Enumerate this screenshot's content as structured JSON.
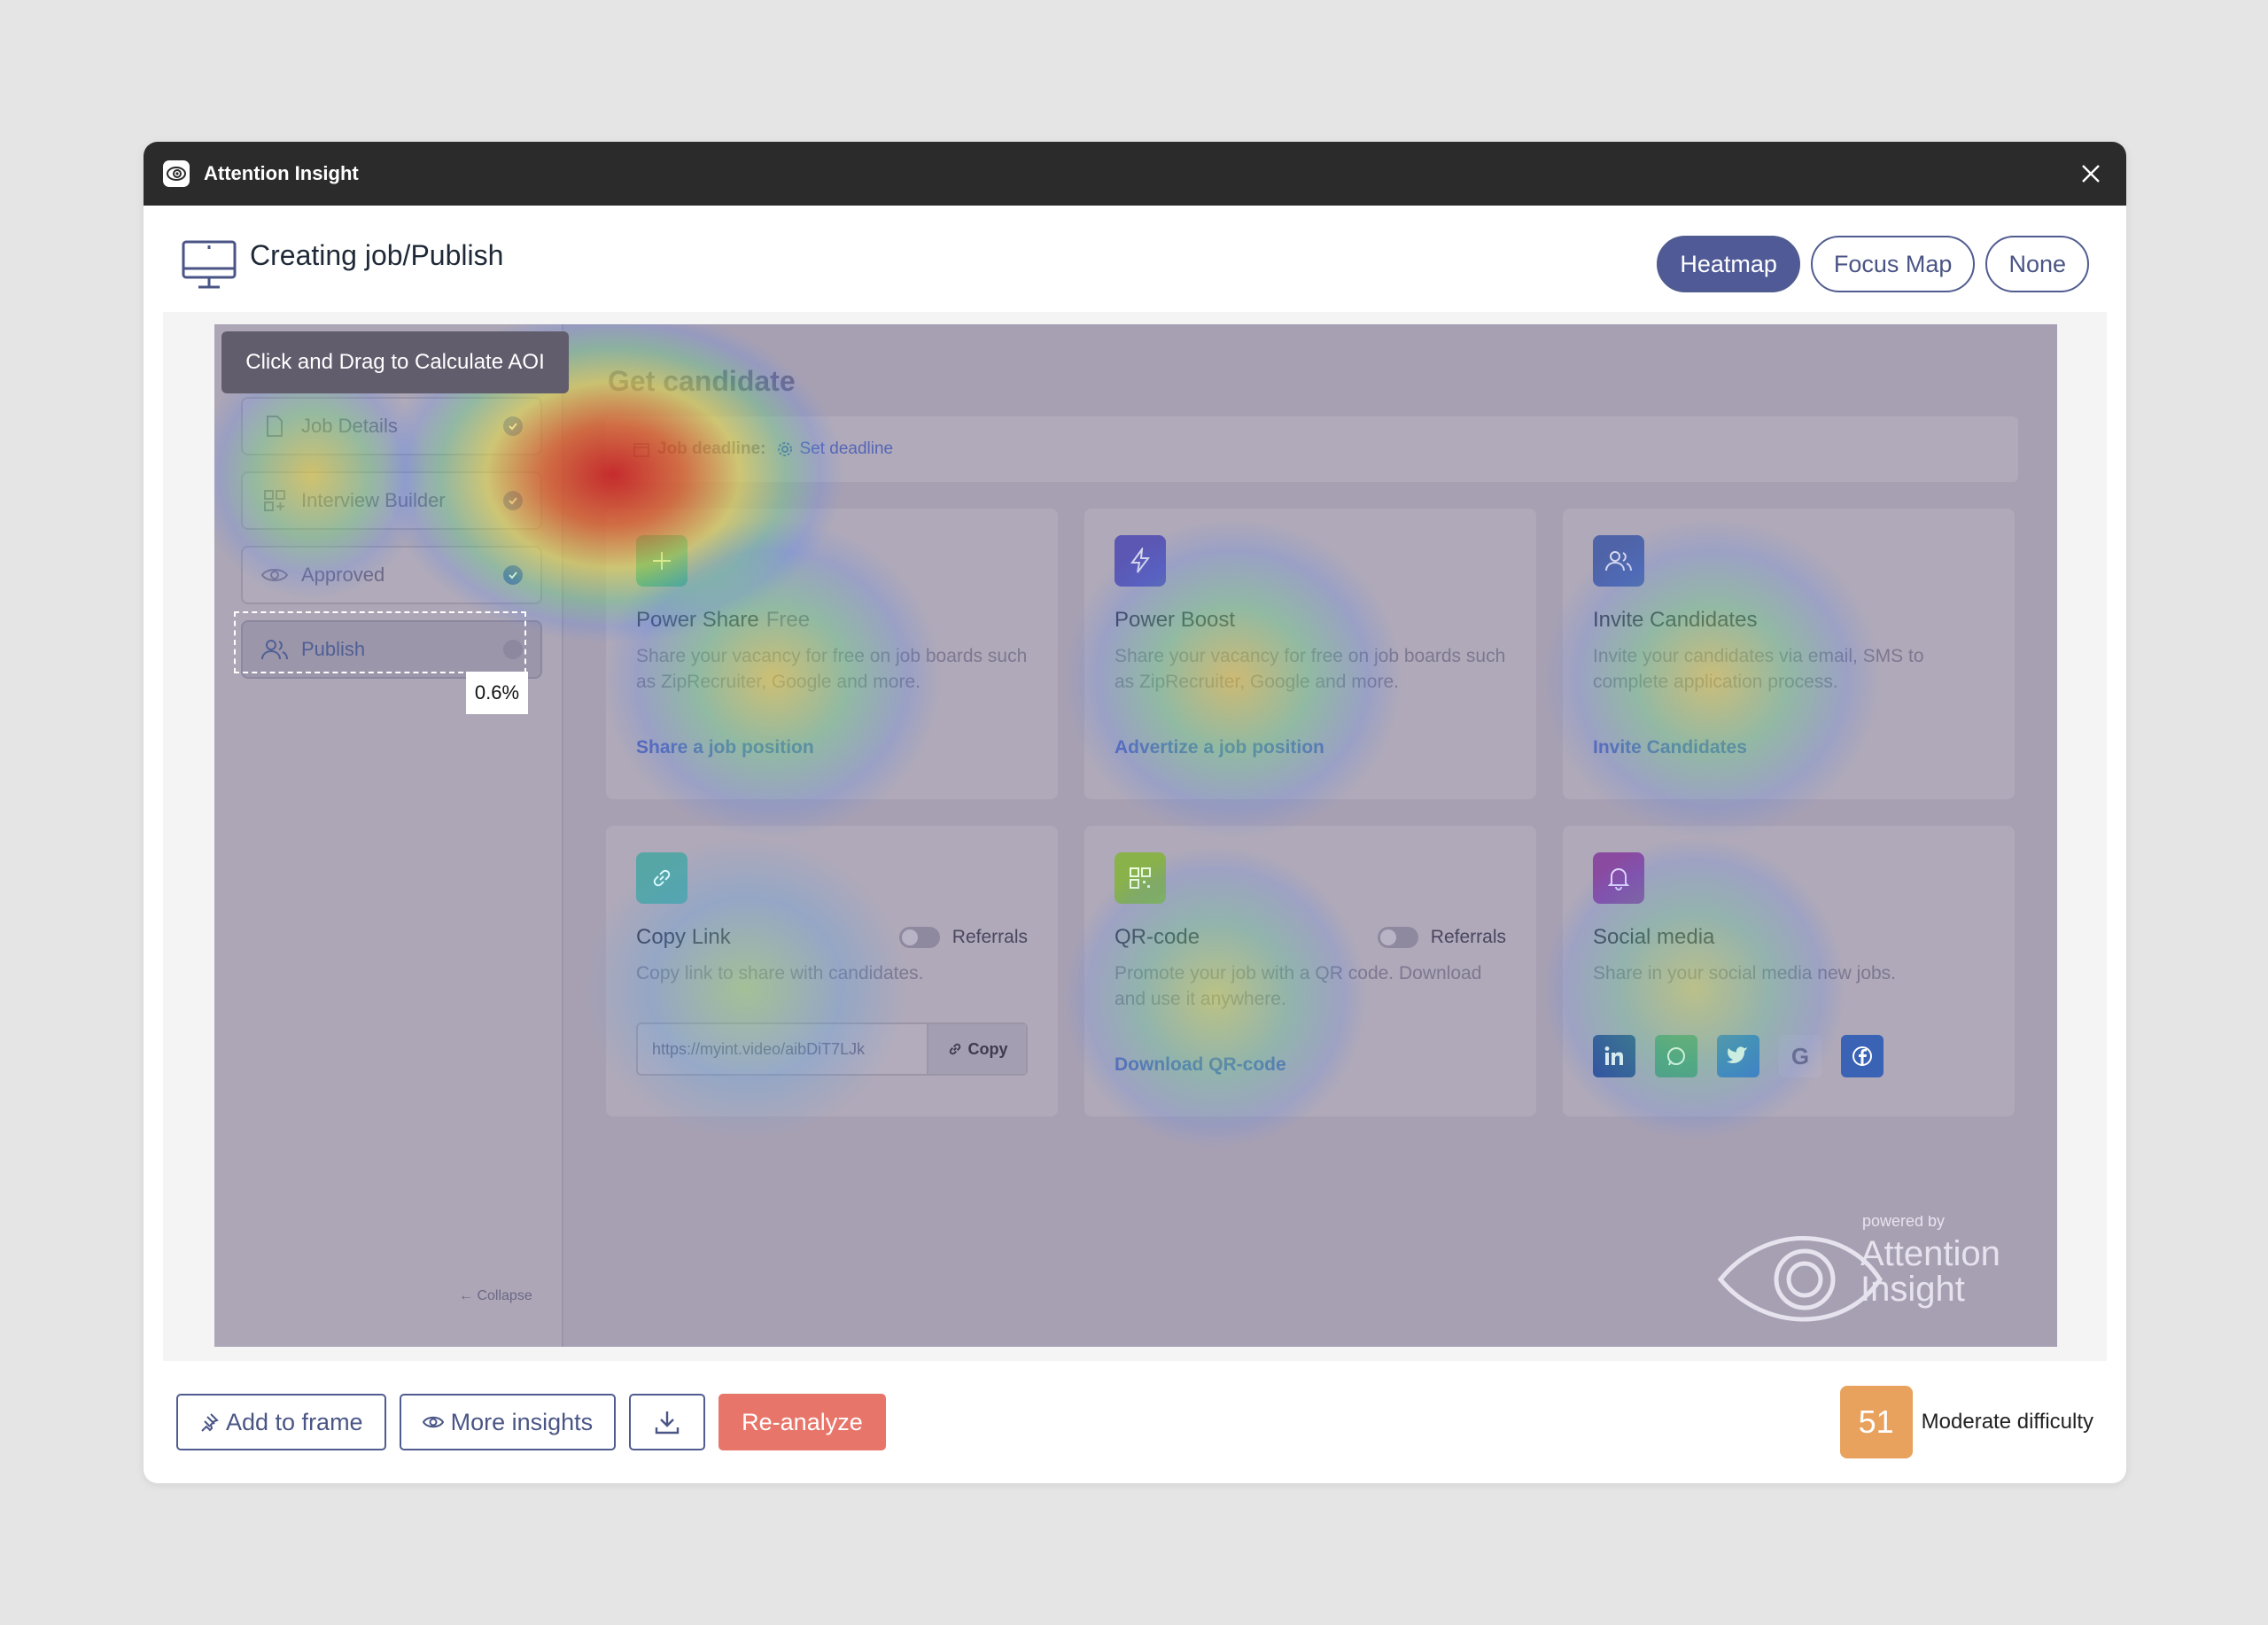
{
  "app": {
    "title": "Attention Insight"
  },
  "header": {
    "title": "Creating job/Publish"
  },
  "view_modes": [
    {
      "label": "Heatmap",
      "active": true
    },
    {
      "label": "Focus Map",
      "active": false
    },
    {
      "label": "None",
      "active": false
    }
  ],
  "aoi": {
    "tooltip": "Click and Drag to Calculate AOI",
    "percent": "0.6%"
  },
  "sidebar": {
    "steps": [
      {
        "label": "Job Details",
        "icon": "document-icon",
        "done": true
      },
      {
        "label": "Interview Builder",
        "icon": "grid-plus-icon",
        "done": true
      },
      {
        "label": "Approved",
        "icon": "eye-icon",
        "done": true
      },
      {
        "label": "Publish",
        "icon": "users-icon",
        "done": false
      }
    ],
    "collapse_label": "Collapse"
  },
  "main": {
    "title": "Get candidate",
    "deadline_label": "Job deadline:",
    "deadline_link": "Set deadline",
    "cards": [
      {
        "title": "Power Share",
        "title_suffix": "Free",
        "desc": "Share your vacancy for free on job boards such as ZipRecruiter, Google and more.",
        "link": "Share a job position",
        "icon": "plus-icon",
        "color": "#3a9f96"
      },
      {
        "title": "Power Boost",
        "desc": "Share your vacancy for free on job boards such as ZipRecruiter, Google and more.",
        "link": "Advertize a job position",
        "icon": "bolt-icon",
        "color": "#5b57b3"
      },
      {
        "title": "Invite Candidates",
        "desc": "Invite your candidates via email, SMS to complete application process.",
        "link": "Invite Candidates",
        "icon": "users-icon",
        "color": "#4f64a8"
      },
      {
        "title": "Copy Link",
        "referrals": "Referrals",
        "desc": "Copy link to share with candidates.",
        "url": "https://myint.video/aibDiT7LJk",
        "copy": "Copy",
        "icon": "link-icon",
        "color": "#56a6a6"
      },
      {
        "title": "QR-code",
        "referrals": "Referrals",
        "desc": "Promote your job with a QR code. Download and use it anywhere.",
        "link": "Download QR-code",
        "icon": "qr-icon",
        "color": "#8ab24a"
      },
      {
        "title": "Social media",
        "desc": "Share in your social media new jobs.",
        "icon": "bell-icon",
        "color": "#8a4aa0"
      }
    ]
  },
  "watermark": {
    "powered": "powered by",
    "line1": "Attention",
    "line2": "Insight"
  },
  "footer": {
    "add_to_frame": "Add to frame",
    "more_insights": "More insights",
    "reanalyze": "Re-analyze",
    "score": "51",
    "score_label": "Moderate difficulty"
  }
}
